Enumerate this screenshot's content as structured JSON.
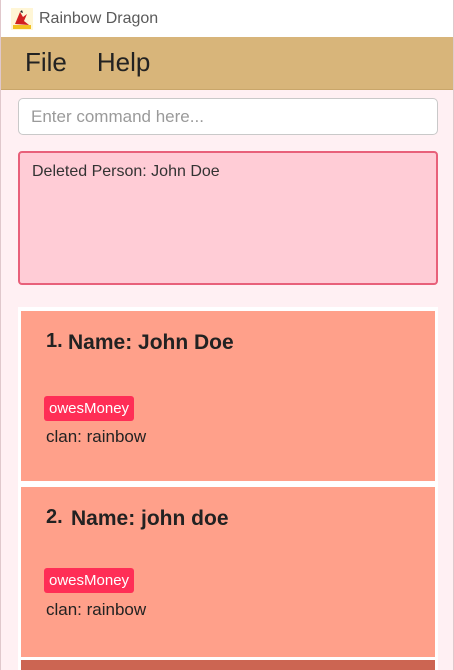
{
  "window": {
    "title": "Rainbow Dragon",
    "icon": "rainbow-dragon-logo"
  },
  "menu": {
    "items": [
      "File",
      "Help"
    ]
  },
  "command": {
    "placeholder": "Enter command here...",
    "value": ""
  },
  "result": {
    "text": "Deleted Person: John Doe"
  },
  "persons": [
    {
      "index": "1.",
      "name": "Name: John Doe",
      "tag": "owesMoney",
      "clan": "clan: rainbow"
    },
    {
      "index": "2.",
      "name": "Name: john doe",
      "tag": "owesMoney",
      "clan": "clan: rainbow"
    }
  ],
  "colors": {
    "menu_bar": "#d8b57a",
    "result_bg": "#ffccd6",
    "result_border": "#e8607a",
    "card_bg": "#ffa08a",
    "tag_bg": "#ff2e56",
    "selected_card": "#cc6552"
  }
}
